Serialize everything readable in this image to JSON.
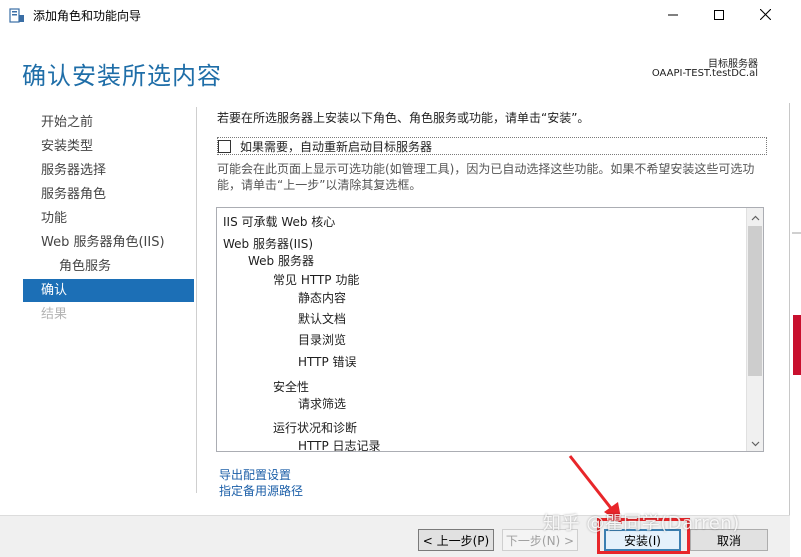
{
  "window": {
    "title": "添加角色和功能向导",
    "controls": {
      "minimize": "minimize-icon",
      "maximize": "maximize-icon",
      "close": "close-icon"
    }
  },
  "header": {
    "page_title": "确认安装所选内容",
    "target_label": "目标服务器",
    "target_server": "OAAPI-TEST.testDC.al"
  },
  "nav": {
    "items": [
      {
        "label": "开始之前",
        "state": "normal"
      },
      {
        "label": "安装类型",
        "state": "normal"
      },
      {
        "label": "服务器选择",
        "state": "normal"
      },
      {
        "label": "服务器角色",
        "state": "normal"
      },
      {
        "label": "功能",
        "state": "normal"
      },
      {
        "label": "Web 服务器角色(IIS)",
        "state": "normal"
      },
      {
        "label": "角色服务",
        "state": "sub"
      },
      {
        "label": "确认",
        "state": "active"
      },
      {
        "label": "结果",
        "state": "disabled"
      }
    ]
  },
  "content": {
    "intro": "若要在所选服务器上安装以下角色、角色服务或功能，请单击“安装”。",
    "restart_checkbox": {
      "label": "如果需要，自动重新启动目标服务器",
      "checked": false
    },
    "note": "可能会在此页面上显示可选功能(如管理工具)，因为已自动选择这些功能。如果不希望安装这些可选功能，请单击“上一步”以清除其复选框。",
    "list": [
      {
        "text": "IIS 可承载 Web 核心",
        "level": 0
      },
      {
        "text": "Web 服务器(IIS)",
        "level": 0
      },
      {
        "text": "Web 服务器",
        "level": 1
      },
      {
        "text": "常见 HTTP 功能",
        "level": 2
      },
      {
        "text": "静态内容",
        "level": 3
      },
      {
        "text": "默认文档",
        "level": 3
      },
      {
        "text": "目录浏览",
        "level": 3
      },
      {
        "text": "HTTP 错误",
        "level": 3
      },
      {
        "text": "安全性",
        "level": 2
      },
      {
        "text": "请求筛选",
        "level": 3
      },
      {
        "text": "运行状况和诊断",
        "level": 2
      },
      {
        "text": "HTTP 日志记录",
        "level": 3
      }
    ],
    "links": {
      "export": "导出配置设置",
      "alt_source": "指定备用源路径"
    }
  },
  "footer": {
    "prev": "< 上一步(P)",
    "next": "下一步(N) >",
    "install": "安装(I)",
    "cancel": "取消"
  },
  "watermark": "知乎 @瞿同学(Darren)",
  "colors": {
    "accent": "#1c6fb6",
    "title": "#1f6ea8",
    "annotation_red": "#e8262a"
  }
}
